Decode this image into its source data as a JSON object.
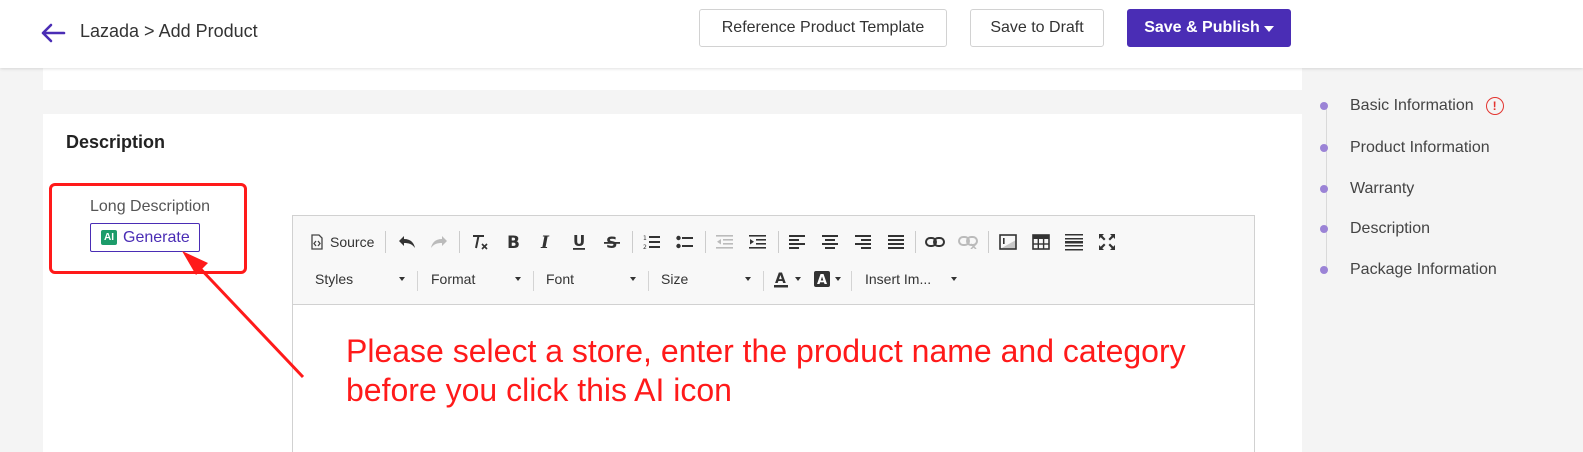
{
  "header": {
    "breadcrumb": "Lazada > Add Product",
    "reference_template_label": "Reference Product Template",
    "save_draft_label": "Save to Draft",
    "save_publish_label": "Save & Publish"
  },
  "section": {
    "title": "Description",
    "long_description_label": "Long Description",
    "generate_badge": "AI",
    "generate_label": "Generate"
  },
  "editor": {
    "source_label": "Source",
    "styles_label": "Styles",
    "format_label": "Format",
    "font_label": "Font",
    "size_label": "Size",
    "insert_image_label": "Insert Im..."
  },
  "annotation": {
    "line1": "Please select a store, enter the product name and category",
    "line2": "before you click this AI icon",
    "color": "#ff1a1a"
  },
  "sidenav": {
    "items": [
      {
        "label": "Basic Information",
        "warning": "!"
      },
      {
        "label": "Product Information"
      },
      {
        "label": "Warranty"
      },
      {
        "label": "Description"
      },
      {
        "label": "Package Information"
      }
    ]
  },
  "colors": {
    "primary": "#4a2db5",
    "ai_badge": "#1c9c6a",
    "nav_dot": "#9b83d6"
  }
}
